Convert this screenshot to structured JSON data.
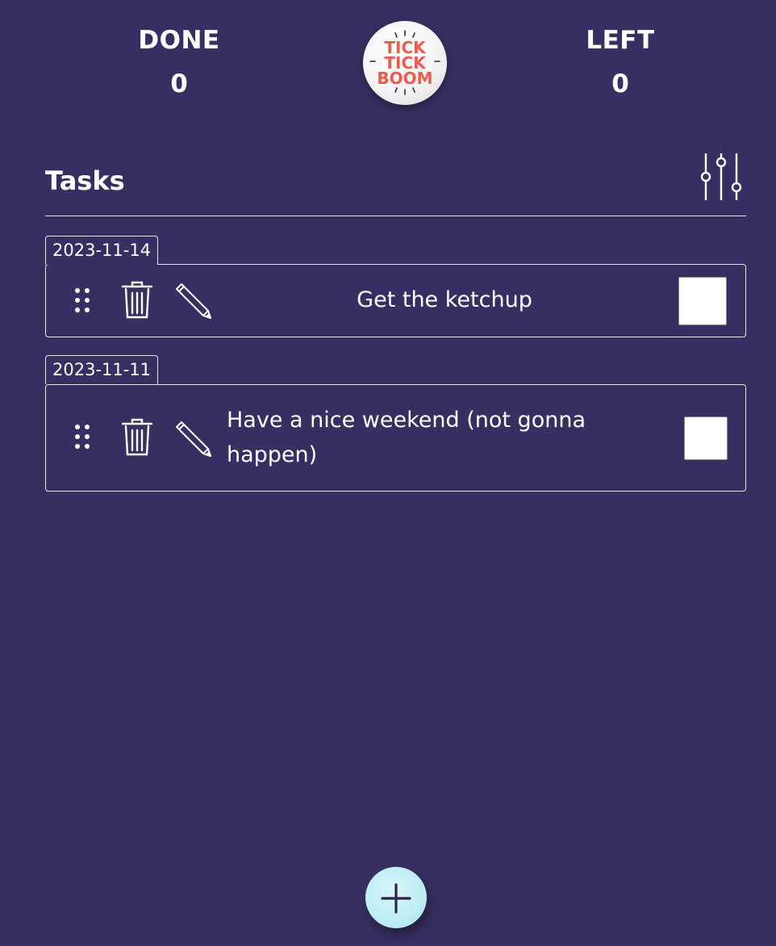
{
  "header": {
    "done": {
      "label": "DONE",
      "value": "0"
    },
    "left": {
      "label": "LEFT",
      "value": "0"
    },
    "logo": {
      "lines": [
        "TICK",
        "TICK",
        "BOOM"
      ],
      "text_color": "#f05a4f"
    }
  },
  "tasks_section": {
    "title": "Tasks",
    "filter_icon": "sliders-icon"
  },
  "task_groups": [
    {
      "date": "2023-11-14",
      "tasks": [
        {
          "text": "Get the ketchup",
          "checked": false
        }
      ]
    },
    {
      "date": "2023-11-11",
      "tasks": [
        {
          "text": "Have a nice weekend (not gonna happen)",
          "checked": false
        }
      ]
    }
  ],
  "icons": {
    "drag": "drag-dots-icon",
    "delete": "trash-icon",
    "edit": "pencil-icon",
    "add": "plus-icon"
  },
  "colors": {
    "background": "#372f61",
    "text": "#ffffff",
    "add_button": "#bdeef6",
    "logo_text": "#f05a4f"
  }
}
